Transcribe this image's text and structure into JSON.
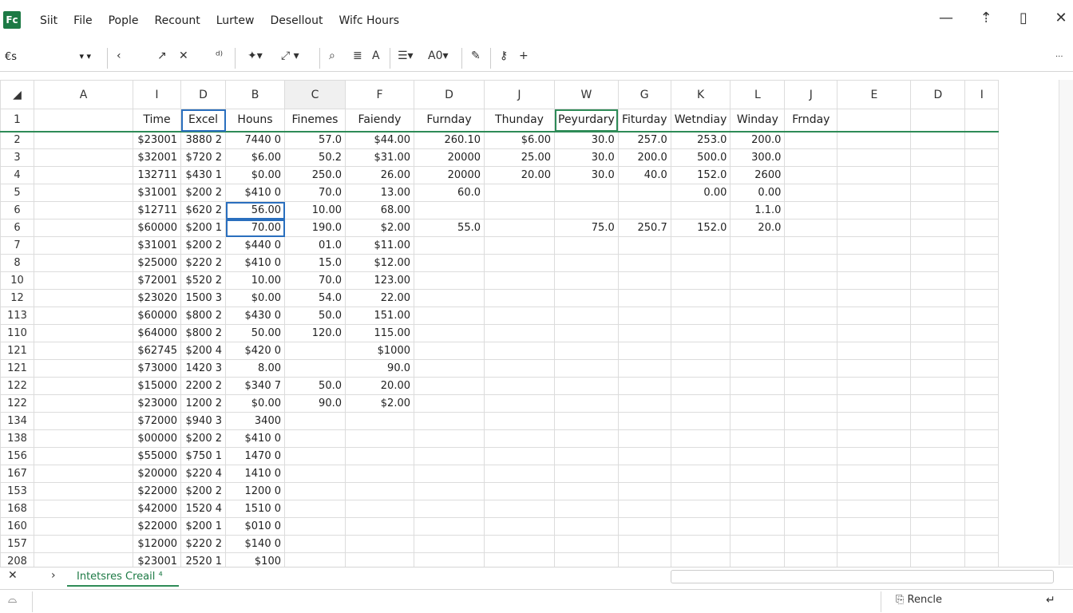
{
  "title_bar": {
    "logo_text": "Fc",
    "menu": [
      "Siit",
      "File",
      "Pople",
      "Recount",
      "Lurtew",
      "Desellout",
      "Wifc Hours"
    ]
  },
  "toolbar": {
    "name_box": "€s",
    "formula_text": ""
  },
  "columns": [
    "A",
    "I",
    "D",
    "B",
    "C",
    "F",
    "D",
    "J",
    "W",
    "G",
    "K",
    "L",
    "J",
    "E",
    "D",
    "I"
  ],
  "header_row": {
    "row_label": "1",
    "cells": [
      "",
      "Time",
      "Excel",
      "Houns",
      "Finemes",
      "Faiendy",
      "Furnday",
      "Thunday",
      "Peyurdary",
      "Fiturday",
      "Wetndiay",
      "Winday",
      "Frnday",
      "",
      "",
      ""
    ]
  },
  "rows": [
    {
      "label": "2",
      "cells": [
        "",
        "$23001",
        "3880 2",
        "7440 0",
        "57.0",
        "$44.00",
        "260.10",
        "$6.00",
        "30.0",
        "257.0",
        "253.0",
        "200.0",
        "",
        "",
        "",
        ""
      ]
    },
    {
      "label": "3",
      "cells": [
        "",
        "$32001",
        "$720 2",
        "$6.00",
        "50.2",
        "$31.00",
        "20000",
        "25.00",
        "30.0",
        "200.0",
        "500.0",
        "300.0",
        "",
        "",
        "",
        ""
      ]
    },
    {
      "label": "4",
      "cells": [
        "",
        "132711",
        "$430 1",
        "$0.00",
        "250.0",
        "26.00",
        "20000",
        "20.00",
        "30.0",
        "40.0",
        "152.0",
        "2600",
        "",
        "",
        "",
        ""
      ]
    },
    {
      "label": "5",
      "cells": [
        "",
        "$31001",
        "$200 2",
        "$410 0",
        "70.0",
        "13.00",
        "60.0",
        "",
        "",
        "",
        "0.00",
        "0.00",
        "",
        "",
        "",
        ""
      ]
    },
    {
      "label": "6",
      "cells": [
        "",
        "$12711",
        "$620 2",
        "56.00",
        "10.00",
        "68.00",
        "",
        "",
        "",
        "",
        "",
        "1.1.0",
        "",
        "",
        "",
        ""
      ]
    },
    {
      "label": "6",
      "cells": [
        "",
        "$60000",
        "$200 1",
        "70.00",
        "190.0",
        "$2.00",
        "55.0",
        "",
        "75.0",
        "250.7",
        "152.0",
        "20.0",
        "",
        "",
        "",
        ""
      ]
    },
    {
      "label": "7",
      "cells": [
        "",
        "$31001",
        "$200 2",
        "$440 0",
        "01.0",
        "$11.00",
        "",
        "",
        "",
        "",
        "",
        "",
        "",
        "",
        "",
        ""
      ]
    },
    {
      "label": "8",
      "cells": [
        "",
        "$25000",
        "$220 2",
        "$410 0",
        "15.0",
        "$12.00",
        "",
        "",
        "",
        "",
        "",
        "",
        "",
        "",
        "",
        ""
      ]
    },
    {
      "label": "10",
      "cells": [
        "",
        "$72001",
        "$520 2",
        "10.00",
        "70.0",
        "123.00",
        "",
        "",
        "",
        "",
        "",
        "",
        "",
        "",
        "",
        ""
      ]
    },
    {
      "label": "12",
      "cells": [
        "",
        "$23020",
        "1500 3",
        "$0.00",
        "54.0",
        "22.00",
        "",
        "",
        "",
        "",
        "",
        "",
        "",
        "",
        "",
        ""
      ]
    },
    {
      "label": "113",
      "cells": [
        "",
        "$60000",
        "$800 2",
        "$430 0",
        "50.0",
        "151.00",
        "",
        "",
        "",
        "",
        "",
        "",
        "",
        "",
        "",
        ""
      ]
    },
    {
      "label": "110",
      "cells": [
        "",
        "$64000",
        "$800 2",
        "50.00",
        "120.0",
        "115.00",
        "",
        "",
        "",
        "",
        "",
        "",
        "",
        "",
        "",
        ""
      ]
    },
    {
      "label": "121",
      "cells": [
        "",
        "$62745",
        "$200 4",
        "$420 0",
        "",
        "$1000",
        "",
        "",
        "",
        "",
        "",
        "",
        "",
        "",
        "",
        ""
      ]
    },
    {
      "label": "121",
      "cells": [
        "",
        "$73000",
        "1420 3",
        "8.00",
        "",
        "90.0",
        "",
        "",
        "",
        "",
        "",
        "",
        "",
        "",
        "",
        ""
      ]
    },
    {
      "label": "122",
      "cells": [
        "",
        "$15000",
        "2200 2",
        "$340 7",
        "50.0",
        "20.00",
        "",
        "",
        "",
        "",
        "",
        "",
        "",
        "",
        "",
        ""
      ]
    },
    {
      "label": "122",
      "cells": [
        "",
        "$23000",
        "1200 2",
        "$0.00",
        "90.0",
        "$2.00",
        "",
        "",
        "",
        "",
        "",
        "",
        "",
        "",
        "",
        ""
      ]
    },
    {
      "label": "134",
      "cells": [
        "",
        "$72000",
        "$940 3",
        "3400",
        "",
        "",
        "",
        "",
        "",
        "",
        "",
        "",
        "",
        "",
        "",
        ""
      ]
    },
    {
      "label": "138",
      "cells": [
        "",
        "$00000",
        "$200 2",
        "$410 0",
        "",
        "",
        "",
        "",
        "",
        "",
        "",
        "",
        "",
        "",
        "",
        ""
      ]
    },
    {
      "label": "156",
      "cells": [
        "",
        "$55000",
        "$750 1",
        "1470 0",
        "",
        "",
        "",
        "",
        "",
        "",
        "",
        "",
        "",
        "",
        "",
        ""
      ]
    },
    {
      "label": "167",
      "cells": [
        "",
        "$20000",
        "$220 4",
        "1410 0",
        "",
        "",
        "",
        "",
        "",
        "",
        "",
        "",
        "",
        "",
        "",
        ""
      ]
    },
    {
      "label": "153",
      "cells": [
        "",
        "$22000",
        "$200 2",
        "1200 0",
        "",
        "",
        "",
        "",
        "",
        "",
        "",
        "",
        "",
        "",
        "",
        ""
      ]
    },
    {
      "label": "168",
      "cells": [
        "",
        "$42000",
        "1520 4",
        "1510 0",
        "",
        "",
        "",
        "",
        "",
        "",
        "",
        "",
        "",
        "",
        "",
        ""
      ]
    },
    {
      "label": "160",
      "cells": [
        "",
        "$22000",
        "$200 1",
        "$010 0",
        "",
        "",
        "",
        "",
        "",
        "",
        "",
        "",
        "",
        "",
        "",
        ""
      ]
    },
    {
      "label": "157",
      "cells": [
        "",
        "$12000",
        "$220 2",
        "$140 0",
        "",
        "",
        "",
        "",
        "",
        "",
        "",
        "",
        "",
        "",
        "",
        ""
      ]
    },
    {
      "label": "208",
      "cells": [
        "",
        "$23001",
        "2520 1",
        "$100",
        "",
        "",
        "",
        "",
        "",
        "",
        "",
        "",
        "",
        "",
        "",
        ""
      ]
    }
  ],
  "sheet_bar": {
    "tab_label": "Intetsres Creail"
  },
  "status_bar": {
    "right_label": "Rencle"
  },
  "colors": {
    "accent": "#1d7a45",
    "selection": "#2a6fbe"
  }
}
